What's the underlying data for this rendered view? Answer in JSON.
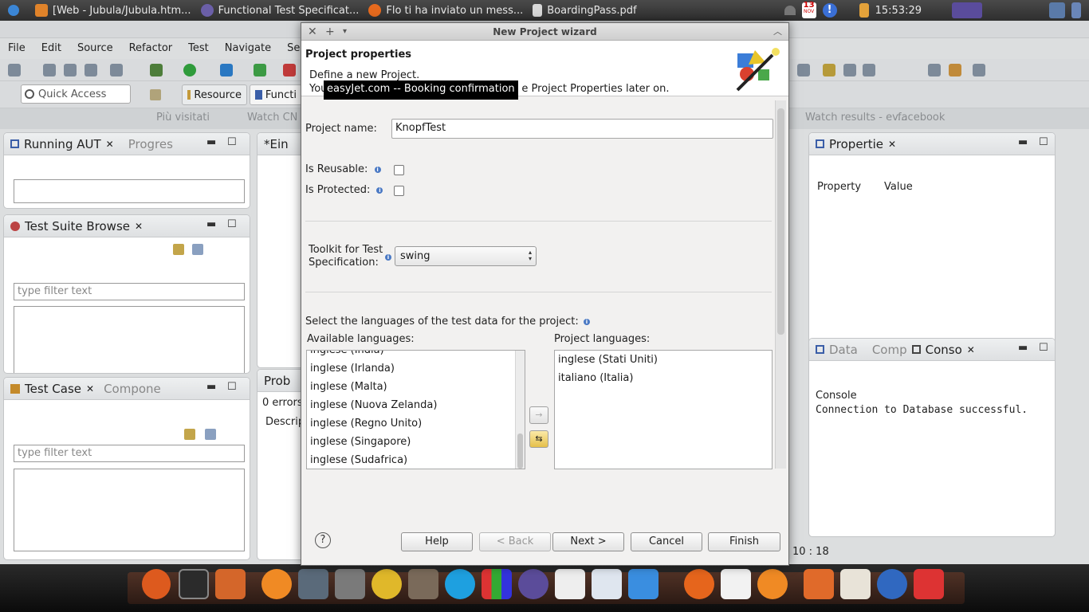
{
  "taskbar": {
    "tasks": [
      "[Web - Jubula/Jubula.htm...",
      "Functional Test Specificat...",
      "Flo ti ha inviato un mess...",
      "BoardingPass.pdf"
    ],
    "calendar_month": "NOV",
    "calendar_day": "13",
    "clock": "15:53:29"
  },
  "eclipse": {
    "menu": [
      "File",
      "Edit",
      "Source",
      "Refactor",
      "Test",
      "Navigate",
      "Sear"
    ],
    "quick_access": "Quick Access",
    "perspective_resource": "Resource",
    "perspective_func": "Functi",
    "bookmarks": [
      "Più visitati",
      "Watch CN",
      "Watch results - ev...",
      "facebook"
    ],
    "views": {
      "running_aut": "Running AUT",
      "progress": "Progres",
      "test_suite_browser": "Test Suite Browse",
      "test_case": "Test Case",
      "component": "Compone",
      "editor": "*Ein",
      "problems": "Prob",
      "problems_errors": "0 errors",
      "problems_desc": "Descrip",
      "properties": "Propertie",
      "prop_col_property": "Property",
      "prop_col_value": "Value",
      "data": "Data",
      "comp": "Comp",
      "console": "Conso",
      "console_title": "Console",
      "console_text": "Connection to Database successful.",
      "status_pos": "10 : 18"
    },
    "filter_placeholder": "type filter text"
  },
  "wizard": {
    "title": "New Project wizard",
    "banner_title": "Project properties",
    "desc_line1": "Define a new Project.",
    "desc_line2_start": "You",
    "desc_line2_end": "e Project Properties later on.",
    "tooltip": "easyJet.com -- Booking confirmation",
    "project_name_label": "Project name:",
    "project_name_value": "KnopfTest",
    "reusable_label": "Is Reusable:",
    "protected_label": "Is Protected:",
    "toolkit_label_line1": "Toolkit for Test",
    "toolkit_label_line2": "Specification:",
    "toolkit_value": "swing",
    "languages_prompt": "Select the languages of the test data for the project:",
    "available_label": "Available languages:",
    "project_languages_label": "Project languages:",
    "available_languages": [
      "inglese (India)",
      "inglese (Irlanda)",
      "inglese (Malta)",
      "inglese (Nuova Zelanda)",
      "inglese (Regno Unito)",
      "inglese (Singapore)",
      "inglese (Sudafrica)"
    ],
    "project_languages": [
      "inglese (Stati Uniti)",
      "italiano (Italia)"
    ],
    "buttons": {
      "help": "Help",
      "back": "< Back",
      "next": "Next >",
      "cancel": "Cancel",
      "finish": "Finish"
    }
  }
}
